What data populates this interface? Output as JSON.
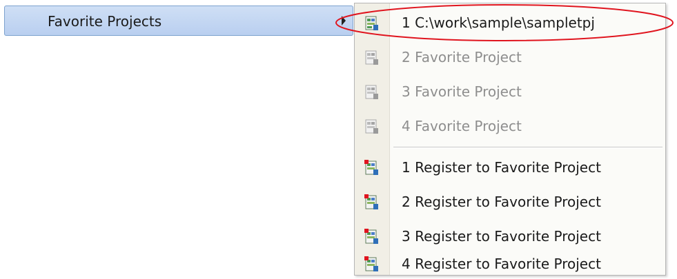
{
  "parent_menu": {
    "label": "Favorite Projects"
  },
  "submenu": {
    "favorites": [
      {
        "label": "1 C:\\work\\sample\\sampletpj",
        "enabled": true,
        "icon": "project-file-icon"
      },
      {
        "label": "2 Favorite Project",
        "enabled": false,
        "icon": "project-file-icon"
      },
      {
        "label": "3 Favorite Project",
        "enabled": false,
        "icon": "project-file-icon"
      },
      {
        "label": "4 Favorite Project",
        "enabled": false,
        "icon": "project-file-icon"
      }
    ],
    "register": [
      {
        "label": "1 Register to Favorite Project",
        "enabled": true,
        "icon": "register-project-icon"
      },
      {
        "label": "2 Register to Favorite Project",
        "enabled": true,
        "icon": "register-project-icon"
      },
      {
        "label": "3 Register to Favorite Project",
        "enabled": true,
        "icon": "register-project-icon"
      },
      {
        "label": "4 Register to Favorite Project",
        "enabled": true,
        "icon": "register-project-icon"
      }
    ]
  },
  "colors": {
    "highlight_ellipse": "#e0141e",
    "parent_highlight": "#c3d6f2",
    "disabled_text": "#8e8e8e"
  }
}
